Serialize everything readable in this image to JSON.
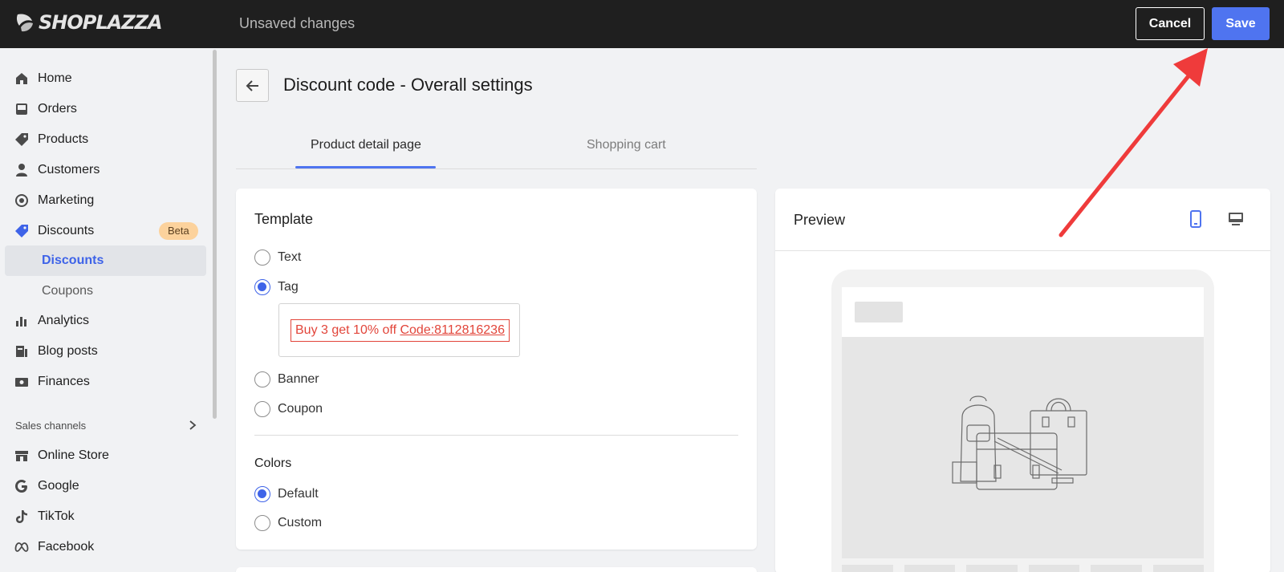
{
  "topbar": {
    "logo_text": "SHOPLAZZA",
    "status": "Unsaved changes",
    "cancel_label": "Cancel",
    "save_label": "Save"
  },
  "sidebar": {
    "items": [
      {
        "label": "Home",
        "icon": "home-icon"
      },
      {
        "label": "Orders",
        "icon": "inbox-icon"
      },
      {
        "label": "Products",
        "icon": "tag-icon"
      },
      {
        "label": "Customers",
        "icon": "person-icon"
      },
      {
        "label": "Marketing",
        "icon": "target-icon"
      },
      {
        "label": "Discounts",
        "icon": "discount-tag-icon",
        "badge": "Beta"
      },
      {
        "label": "Analytics",
        "icon": "bar-chart-icon"
      },
      {
        "label": "Blog posts",
        "icon": "document-icon"
      },
      {
        "label": "Finances",
        "icon": "money-icon"
      }
    ],
    "sub_items": [
      {
        "label": "Discounts",
        "active": true
      },
      {
        "label": "Coupons",
        "active": false
      }
    ],
    "section_label": "Sales channels",
    "channels": [
      {
        "label": "Online Store",
        "icon": "store-icon"
      },
      {
        "label": "Google",
        "icon": "google-icon"
      },
      {
        "label": "TikTok",
        "icon": "tiktok-icon"
      },
      {
        "label": "Facebook",
        "icon": "meta-icon"
      }
    ]
  },
  "main": {
    "title": "Discount code - Overall settings",
    "tabs": [
      {
        "label": "Product detail page",
        "active": true
      },
      {
        "label": "Shopping cart",
        "active": false
      }
    ],
    "template": {
      "title": "Template",
      "options": [
        {
          "label": "Text",
          "checked": false
        },
        {
          "label": "Tag",
          "checked": true
        },
        {
          "label": "Banner",
          "checked": false
        },
        {
          "label": "Coupon",
          "checked": false
        }
      ],
      "tag_preview": {
        "text": "Buy 3 get 10% off",
        "code": "Code:8112816236"
      }
    },
    "colors": {
      "title": "Colors",
      "options": [
        {
          "label": "Default",
          "checked": true
        },
        {
          "label": "Custom",
          "checked": false
        }
      ]
    },
    "preview": {
      "title": "Preview",
      "active_device": "mobile"
    }
  },
  "theme": {
    "accent": "#4f74f0",
    "topbar_bg": "#1f1f1f",
    "tag_red": "#e2453a",
    "annotation_red": "#ef3b3b"
  }
}
